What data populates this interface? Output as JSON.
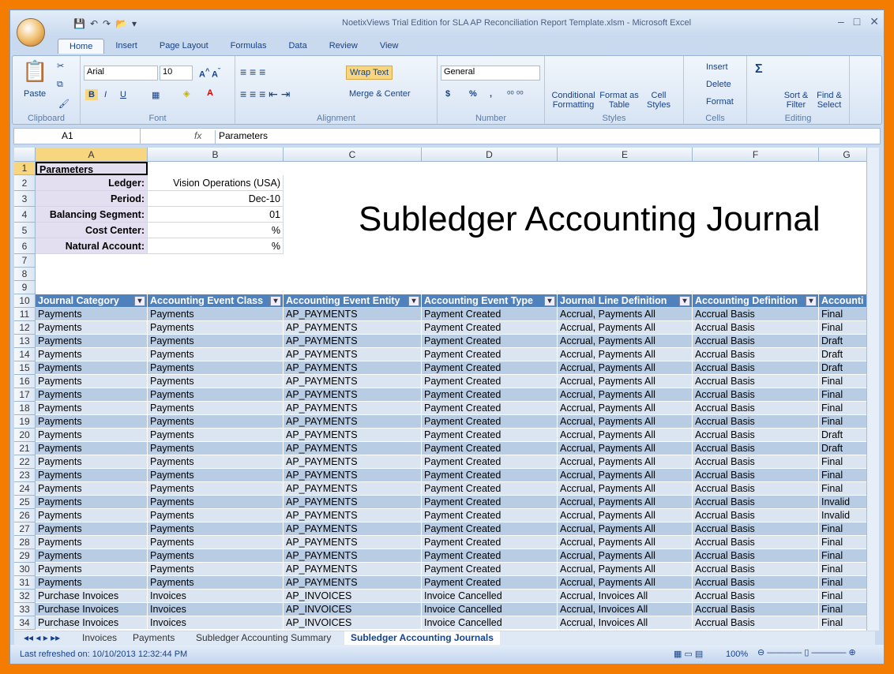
{
  "app": {
    "title": "NoetixViews Trial Edition for SLA AP Reconciliation Report Template.xlsm - Microsoft Excel"
  },
  "ribbon_tabs": [
    "Home",
    "Insert",
    "Page Layout",
    "Formulas",
    "Data",
    "Review",
    "View"
  ],
  "ribbon": {
    "clipboard": {
      "paste": "Paste",
      "label": "Clipboard"
    },
    "font": {
      "name": "Arial",
      "size": "10",
      "label": "Font"
    },
    "alignment": {
      "wrap": "Wrap Text",
      "merge": "Merge & Center",
      "label": "Alignment"
    },
    "number": {
      "format": "General",
      "currency": "$",
      "percent": "%",
      "comma": ",",
      "label": "Number"
    },
    "styles": {
      "conditional": "Conditional Formatting",
      "table": "Format as Table",
      "cell": "Cell Styles",
      "label": "Styles"
    },
    "cells": {
      "insert": "Insert",
      "delete": "Delete",
      "format": "Format",
      "label": "Cells"
    },
    "editing": {
      "sum": "Σ",
      "sort": "Sort & Filter",
      "find": "Find & Select",
      "label": "Editing"
    }
  },
  "formula_bar": {
    "name_box": "A1",
    "fx": "fx",
    "value": "Parameters"
  },
  "columns": [
    "A",
    "B",
    "C",
    "D",
    "E",
    "F",
    "G"
  ],
  "parameters": {
    "title": "Parameters",
    "items": [
      [
        "Ledger:",
        "Vision Operations (USA)"
      ],
      [
        "Period:",
        "Dec-10"
      ],
      [
        "Balancing Segment:",
        "01"
      ],
      [
        "Cost Center:",
        "%"
      ],
      [
        "Natural Account:",
        "%"
      ]
    ]
  },
  "big_title": "Subledger Accounting Journal",
  "table": {
    "headers": [
      "Journal Category",
      "Accounting Event Class",
      "Accounting Event Entity",
      "Accounting Event Type",
      "Journal Line Definition",
      "Accounting Definition",
      "Accounti"
    ],
    "rows": [
      [
        "Payments",
        "Payments",
        "AP_PAYMENTS",
        "Payment Created",
        "Accrual, Payments All",
        "Accrual Basis",
        "Final"
      ],
      [
        "Payments",
        "Payments",
        "AP_PAYMENTS",
        "Payment Created",
        "Accrual, Payments All",
        "Accrual Basis",
        "Final"
      ],
      [
        "Payments",
        "Payments",
        "AP_PAYMENTS",
        "Payment Created",
        "Accrual, Payments All",
        "Accrual Basis",
        "Draft"
      ],
      [
        "Payments",
        "Payments",
        "AP_PAYMENTS",
        "Payment Created",
        "Accrual, Payments All",
        "Accrual Basis",
        "Draft"
      ],
      [
        "Payments",
        "Payments",
        "AP_PAYMENTS",
        "Payment Created",
        "Accrual, Payments All",
        "Accrual Basis",
        "Draft"
      ],
      [
        "Payments",
        "Payments",
        "AP_PAYMENTS",
        "Payment Created",
        "Accrual, Payments All",
        "Accrual Basis",
        "Final"
      ],
      [
        "Payments",
        "Payments",
        "AP_PAYMENTS",
        "Payment Created",
        "Accrual, Payments All",
        "Accrual Basis",
        "Final"
      ],
      [
        "Payments",
        "Payments",
        "AP_PAYMENTS",
        "Payment Created",
        "Accrual, Payments All",
        "Accrual Basis",
        "Final"
      ],
      [
        "Payments",
        "Payments",
        "AP_PAYMENTS",
        "Payment Created",
        "Accrual, Payments All",
        "Accrual Basis",
        "Final"
      ],
      [
        "Payments",
        "Payments",
        "AP_PAYMENTS",
        "Payment Created",
        "Accrual, Payments All",
        "Accrual Basis",
        "Draft"
      ],
      [
        "Payments",
        "Payments",
        "AP_PAYMENTS",
        "Payment Created",
        "Accrual, Payments All",
        "Accrual Basis",
        "Draft"
      ],
      [
        "Payments",
        "Payments",
        "AP_PAYMENTS",
        "Payment Created",
        "Accrual, Payments All",
        "Accrual Basis",
        "Final"
      ],
      [
        "Payments",
        "Payments",
        "AP_PAYMENTS",
        "Payment Created",
        "Accrual, Payments All",
        "Accrual Basis",
        "Final"
      ],
      [
        "Payments",
        "Payments",
        "AP_PAYMENTS",
        "Payment Created",
        "Accrual, Payments All",
        "Accrual Basis",
        "Final"
      ],
      [
        "Payments",
        "Payments",
        "AP_PAYMENTS",
        "Payment Created",
        "Accrual, Payments All",
        "Accrual Basis",
        "Invalid"
      ],
      [
        "Payments",
        "Payments",
        "AP_PAYMENTS",
        "Payment Created",
        "Accrual, Payments All",
        "Accrual Basis",
        "Invalid"
      ],
      [
        "Payments",
        "Payments",
        "AP_PAYMENTS",
        "Payment Created",
        "Accrual, Payments All",
        "Accrual Basis",
        "Final"
      ],
      [
        "Payments",
        "Payments",
        "AP_PAYMENTS",
        "Payment Created",
        "Accrual, Payments All",
        "Accrual Basis",
        "Final"
      ],
      [
        "Payments",
        "Payments",
        "AP_PAYMENTS",
        "Payment Created",
        "Accrual, Payments All",
        "Accrual Basis",
        "Final"
      ],
      [
        "Payments",
        "Payments",
        "AP_PAYMENTS",
        "Payment Created",
        "Accrual, Payments All",
        "Accrual Basis",
        "Final"
      ],
      [
        "Payments",
        "Payments",
        "AP_PAYMENTS",
        "Payment Created",
        "Accrual, Payments All",
        "Accrual Basis",
        "Final"
      ],
      [
        "Purchase Invoices",
        "Invoices",
        "AP_INVOICES",
        "Invoice Cancelled",
        "Accrual, Invoices All",
        "Accrual Basis",
        "Final"
      ],
      [
        "Purchase Invoices",
        "Invoices",
        "AP_INVOICES",
        "Invoice Cancelled",
        "Accrual, Invoices All",
        "Accrual Basis",
        "Final"
      ],
      [
        "Purchase Invoices",
        "Invoices",
        "AP_INVOICES",
        "Invoice Cancelled",
        "Accrual, Invoices All",
        "Accrual Basis",
        "Final"
      ]
    ]
  },
  "sheet_tabs": [
    "Invoices",
    "Payments",
    "Subledger Accounting Summary",
    "Subledger Accounting Journals"
  ],
  "active_sheet": "Subledger Accounting Journals",
  "status": {
    "text": "Last refreshed on: 10/10/2013 12:32:44 PM",
    "zoom": "100%"
  },
  "colors": {
    "header": "#4f81bd",
    "band_dark": "#b8cce4",
    "band_light": "#dbe5f1",
    "param_bg": "#e4dff0",
    "frame": "#f47c00"
  }
}
